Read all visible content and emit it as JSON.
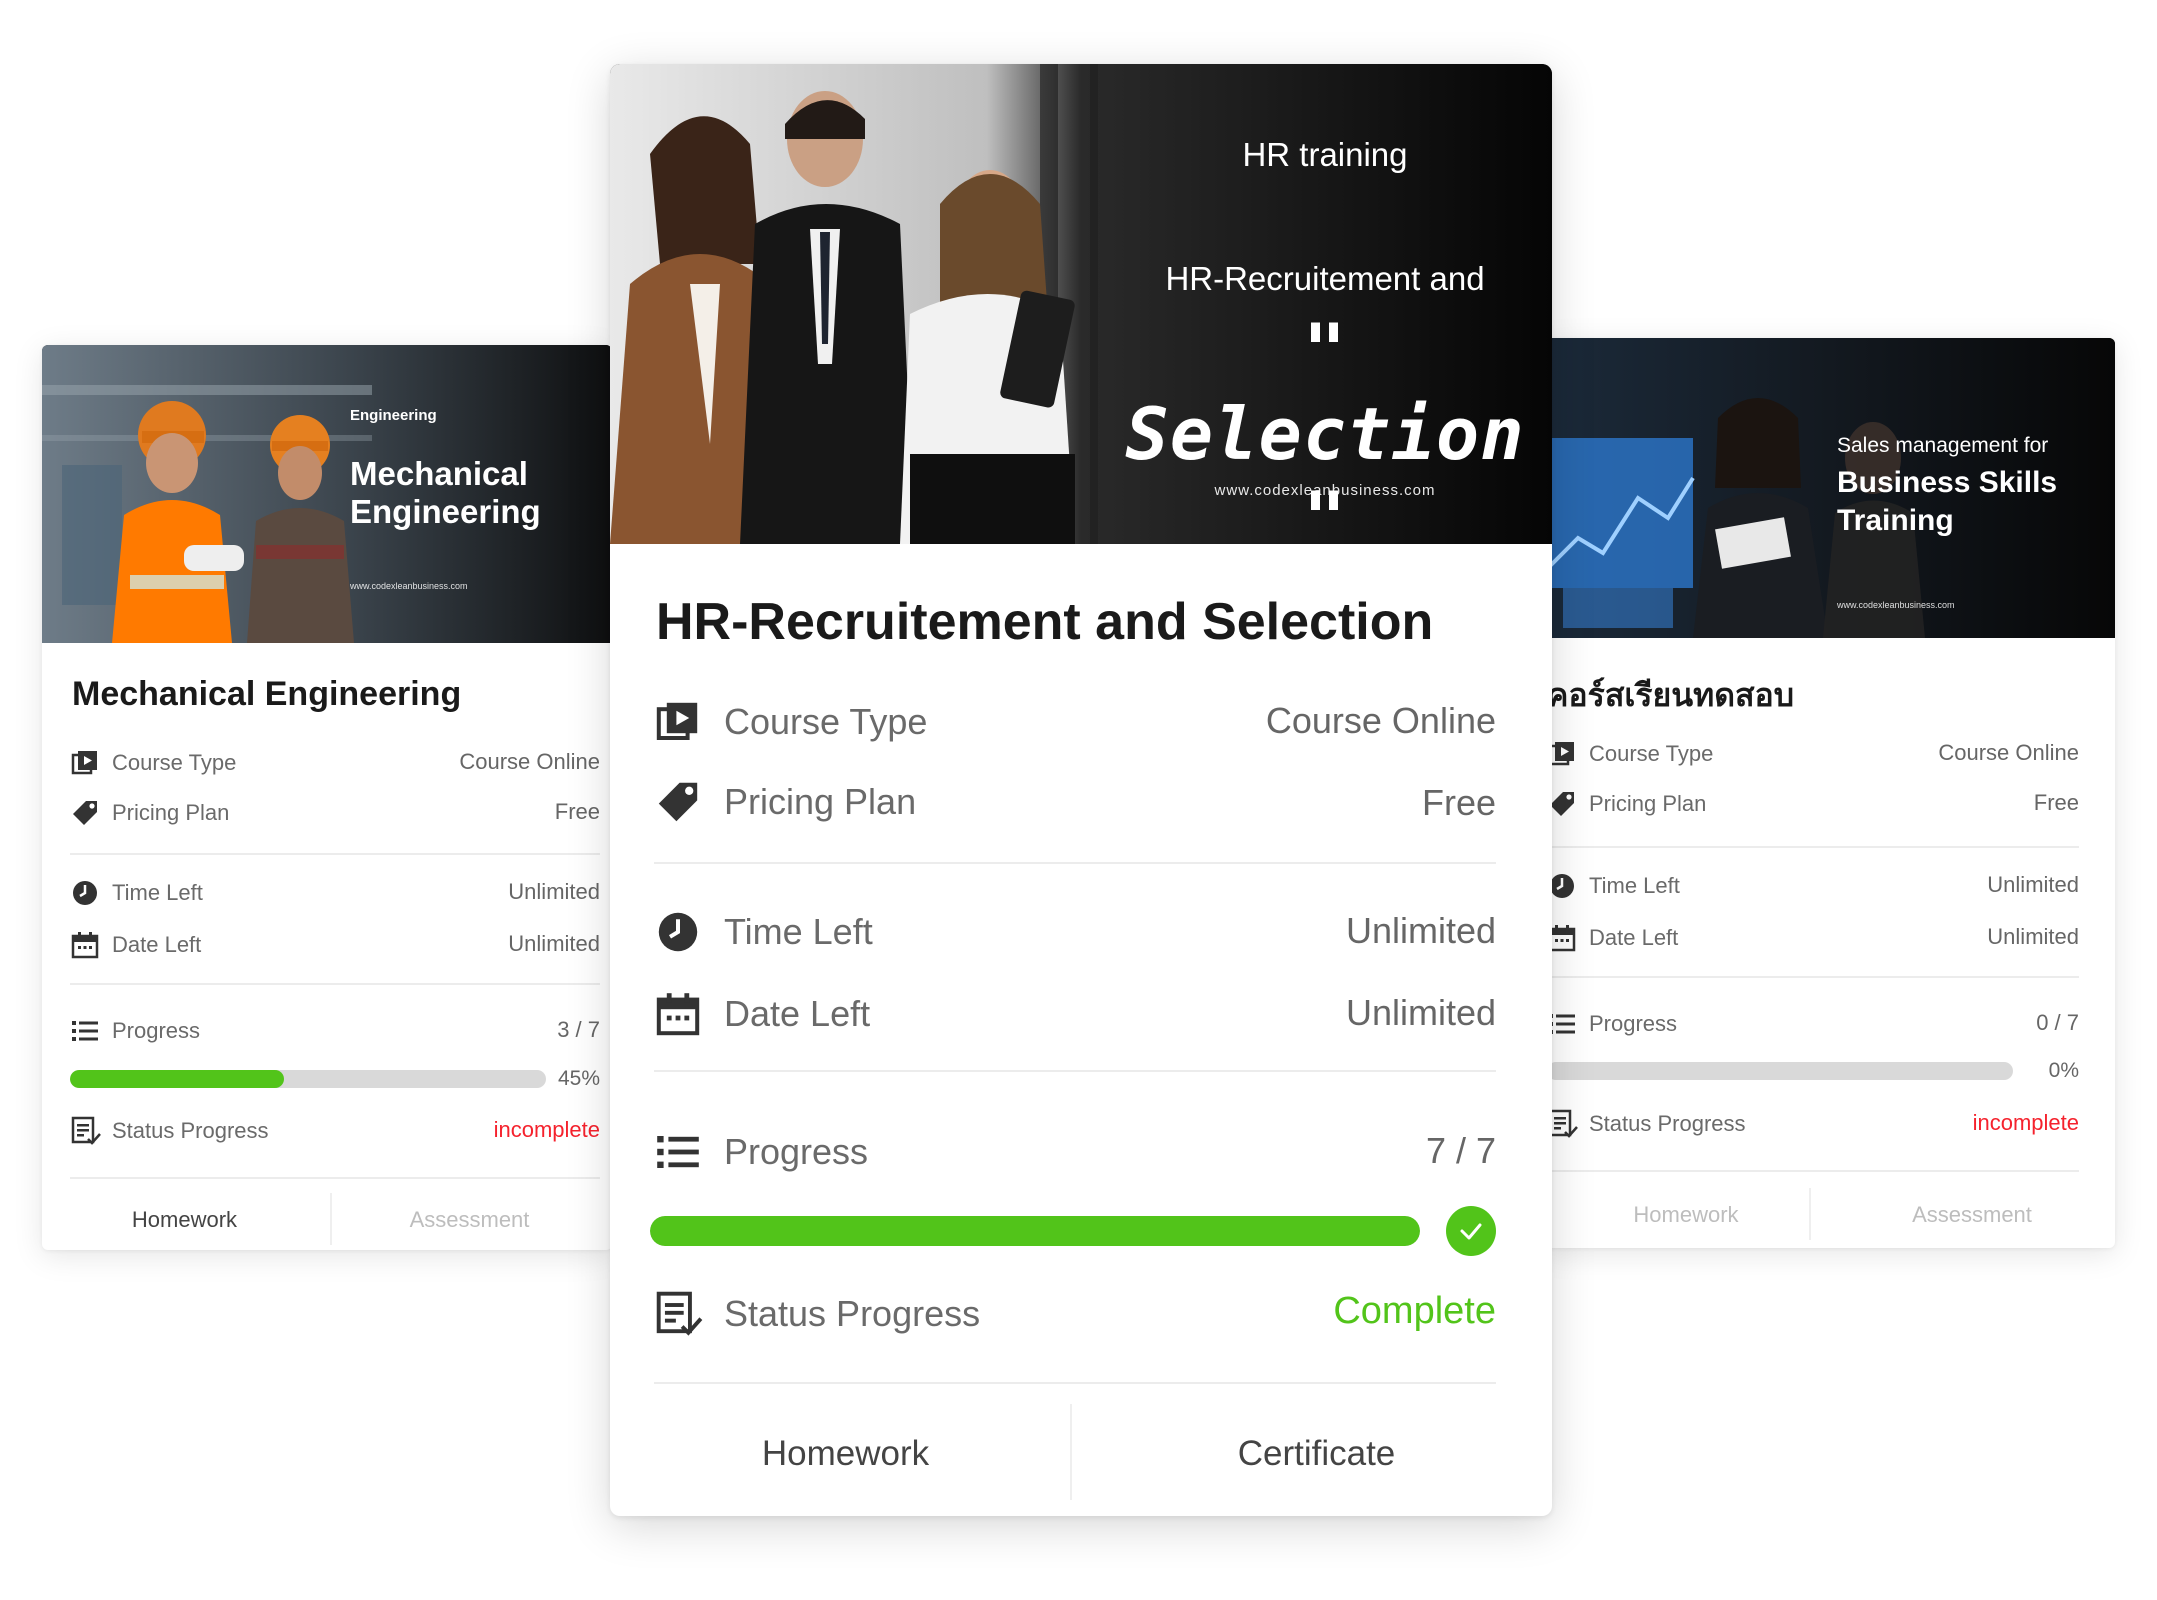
{
  "cards": {
    "left": {
      "banner": {
        "kicker": "Engineering",
        "title_line1": "Mechanical",
        "title_line2": "Engineering",
        "url": "www.codexleanbusiness.com"
      },
      "title": "Mechanical Engineering",
      "course_type": {
        "label": "Course Type",
        "value": "Course Online"
      },
      "pricing_plan": {
        "label": "Pricing Plan",
        "value": "Free"
      },
      "time_left": {
        "label": "Time Left",
        "value": "Unlimited"
      },
      "date_left": {
        "label": "Date Left",
        "value": "Unlimited"
      },
      "progress": {
        "label": "Progress",
        "value": "3 / 7",
        "percent_label": "45%",
        "fraction": 0.45
      },
      "status": {
        "label": "Status Progress",
        "value": "incomplete"
      },
      "tabs": [
        "Homework",
        "Assessment"
      ]
    },
    "main": {
      "banner": {
        "line1": "HR training",
        "line2": "HR-Recruitement and",
        "line3": "\" Selection \"",
        "url": "www.codexleanbusiness.com"
      },
      "title": "HR-Recruitement and Selection",
      "course_type": {
        "label": "Course Type",
        "value": "Course Online"
      },
      "pricing_plan": {
        "label": "Pricing Plan",
        "value": "Free"
      },
      "time_left": {
        "label": "Time Left",
        "value": "Unlimited"
      },
      "date_left": {
        "label": "Date Left",
        "value": "Unlimited"
      },
      "progress": {
        "label": "Progress",
        "value": "7 / 7",
        "fraction": 1.0
      },
      "status": {
        "label": "Status Progress",
        "value": "Complete"
      },
      "tabs": [
        "Homework",
        "Certificate"
      ]
    },
    "right": {
      "banner": {
        "line1": "Sales management for",
        "line2": "Business Skills",
        "line3": "Training",
        "url": "www.codexleanbusiness.com"
      },
      "title": "คอร์สเรียนทดสอบ",
      "course_type": {
        "label": "Course Type",
        "value": "Course Online"
      },
      "pricing_plan": {
        "label": "Pricing Plan",
        "value": "Free"
      },
      "time_left": {
        "label": "Time Left",
        "value": "Unlimited"
      },
      "date_left": {
        "label": "Date Left",
        "value": "Unlimited"
      },
      "progress": {
        "label": "Progress",
        "value": "0 / 7",
        "percent_label": "0%",
        "fraction": 0.0
      },
      "status": {
        "label": "Status Progress",
        "value": "incomplete"
      },
      "tabs": [
        "Homework",
        "Assessment"
      ]
    }
  },
  "colors": {
    "progress_fill": "#52c41a",
    "progress_track": "#d9d9d9",
    "incomplete": "#f5222d",
    "complete": "#52c41a",
    "title": "#1a1a1a"
  },
  "icons": {
    "course_type": "play-library-icon",
    "pricing_plan": "price-tag-icon",
    "time_left": "clock-icon",
    "date_left": "calendar-icon",
    "progress": "list-icon",
    "status": "checklist-document-icon",
    "complete": "check-circle-icon"
  }
}
